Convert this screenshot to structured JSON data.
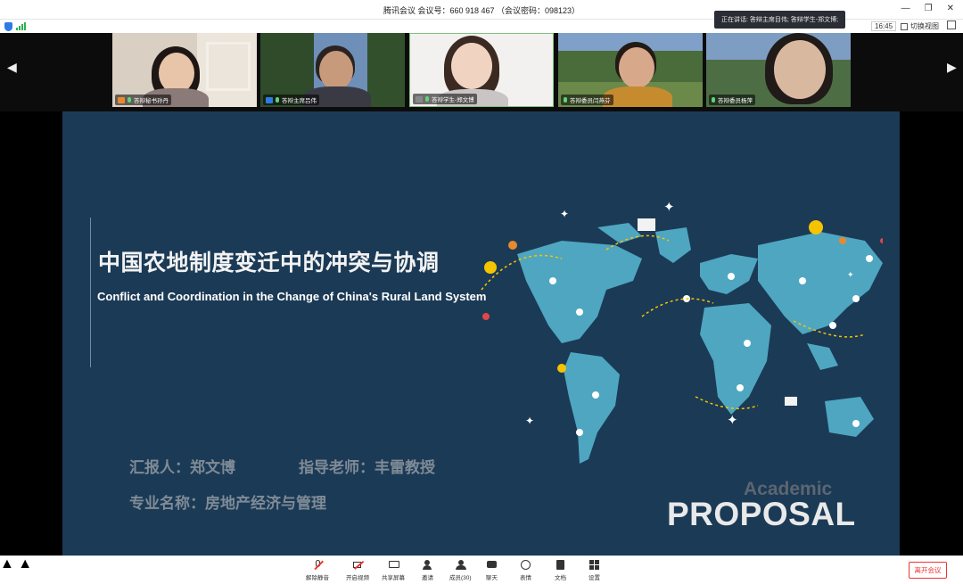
{
  "window": {
    "title": "腾讯会议 会议号：660 918 467 （会议密码：098123）"
  },
  "infobar": {
    "speaking": "正在讲话: 答辩主席目伟; 答辩学生-郑文博;",
    "clock": "16:45",
    "switch_view": "切换视图"
  },
  "participants": [
    {
      "name": "答辩秘书孙丹"
    },
    {
      "name": "答辩主席吕伟"
    },
    {
      "name": "答辩学生-郑文博"
    },
    {
      "name": "答辩委员闫燕芬"
    },
    {
      "name": "答辩委员杨萍"
    }
  ],
  "slide": {
    "title_cn": "中国农地制度变迁中的冲突与协调",
    "title_en": "Conflict and Coordination in the Change of China's Rural Land System",
    "reporter": "汇报人：郑文博",
    "advisor": "指导老师：丰雷教授",
    "major": "专业名称：房地产经济与管理",
    "academic": "Academic",
    "proposal": "PROPOSAL"
  },
  "toolbar": {
    "mute": "解除静音",
    "video": "开启视频",
    "share": "共享屏幕",
    "invite": "邀请",
    "members": "成员(30)",
    "chat": "聊天",
    "emoji": "表情",
    "docs": "文档",
    "settings": "设置",
    "leave": "离开会议"
  },
  "colors": {
    "slide_bg": "#1b3a56",
    "map": "#4fa6c0",
    "leave_red": "#e33333",
    "accent_yellow": "#f5c400"
  }
}
